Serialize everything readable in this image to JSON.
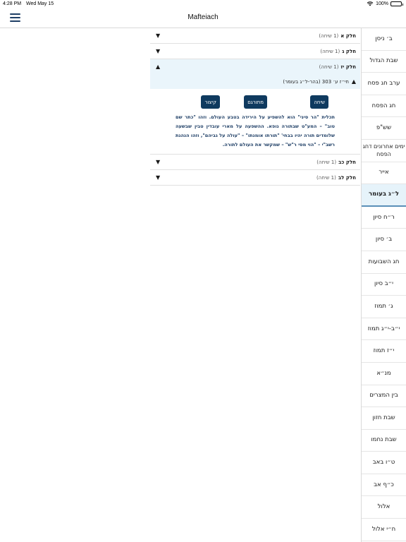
{
  "status_bar": {
    "time": "4:28 PM",
    "date": "Wed May 15",
    "battery": "100%"
  },
  "nav": {
    "title": "Mafteiach"
  },
  "sections": [
    {
      "title": "חלק א",
      "count": "(1 שיחה)",
      "expanded": false
    },
    {
      "title": "חלק ג",
      "count": "(1 שיחה)",
      "expanded": false
    },
    {
      "title": "חלק יז",
      "count": "(1 שיחה)",
      "expanded": true
    },
    {
      "title": "חלק כב",
      "count": "(1 שיחה)",
      "expanded": false
    },
    {
      "title": "חלק לב",
      "count": "(1 שיחה)",
      "expanded": false
    }
  ],
  "expanded": {
    "sub_item": "חי״ז ע׳ 303 (בהר-ל״ג בעומר)",
    "buttons": {
      "sicha": "שיחה",
      "translated": "מתורגם",
      "summary": "קיצור"
    },
    "summary_text": "תכלית \"הר סיני\" הוא להשפיע על הירידה בטבע העולם. וזהו \"כתר שם טוב\" – המע\"ט שבתורה גופא. ההשפעה על מארי עובדין טבין שבשעה שלומדים תורה יהיו בבחי' \"תורתו אומנתו\" – \"עולה על גביהם\", וזהו הנהגת רשב\"י – \"הוי מסי ר\"ש\" – שמקשר את העולם לתורה."
  },
  "sidebar": {
    "active_index": 7,
    "items": [
      "ב׳ ניסן",
      "שבת הגדול",
      "ערב חג פסח",
      "חג הפסח",
      "שש\"פ",
      "ימים אחרונים דחג הפסח",
      "אייר",
      "ל״ג בעומר",
      "ר״ח סיון",
      "ב׳ סיון",
      "חג השבועות",
      "י״ב סיון",
      "ג׳ תמוז",
      "י״ב-י״ג תמוז",
      "י״ז תמוז",
      "מנ״א",
      "בין המצרים",
      "שבת חזון",
      "שבת נחמו",
      "ט״ו באב",
      "כ״ף אב",
      "אלול",
      "ח״י אלול"
    ]
  }
}
